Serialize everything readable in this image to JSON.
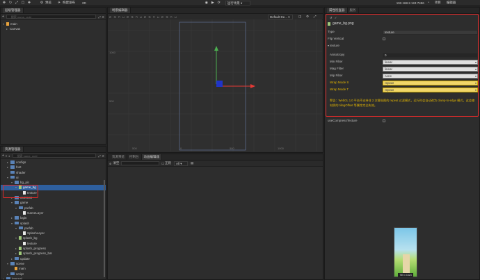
{
  "topbar": {
    "preview": "预览",
    "build": "构建发布",
    "mode": "2D",
    "scene_dropdown": "运行场景",
    "ip": "192.168.2.124:7456",
    "project": "项目",
    "editor": "编辑器"
  },
  "hierarchy": {
    "title": "层级管理器",
    "search_placeholder": "搜索 name, uuid",
    "nodes": [
      {
        "label": "main",
        "level": 0,
        "arrow": "▾"
      },
      {
        "label": "Canvas",
        "level": 1,
        "arrow": "▸"
      }
    ]
  },
  "scene": {
    "title": "场景编辑器",
    "design_dropdown": "Default De...",
    "axis_labels": [
      "1000",
      "500",
      "0",
      "500",
      "1000"
    ],
    "y_labels": [
      "1000",
      "500"
    ]
  },
  "assets": {
    "title": "资源管理器",
    "search_placeholder": "搜索 name, uuid",
    "items": [
      {
        "label": "configs",
        "level": 1,
        "arrow": "▸",
        "type": "folder"
      },
      {
        "label": "font",
        "level": 1,
        "arrow": "▸",
        "type": "folder"
      },
      {
        "label": "shader",
        "level": 1,
        "arrow": "",
        "type": "folder"
      },
      {
        "label": "ui",
        "level": 1,
        "arrow": "▾",
        "type": "folder"
      },
      {
        "label": "bg_pic",
        "level": 2,
        "arrow": "▾",
        "type": "folder"
      },
      {
        "label": "game_bg",
        "level": 3,
        "arrow": "▾",
        "type": "image",
        "selected": true
      },
      {
        "label": "texture",
        "level": 4,
        "arrow": "",
        "type": "file"
      },
      {
        "label": "common",
        "level": 2,
        "arrow": "▸",
        "type": "folder"
      },
      {
        "label": "game",
        "level": 2,
        "arrow": "▾",
        "type": "folder"
      },
      {
        "label": "prefab",
        "level": 3,
        "arrow": "▾",
        "type": "folder"
      },
      {
        "label": "GameLayer",
        "level": 4,
        "arrow": "",
        "type": "file"
      },
      {
        "label": "login",
        "level": 2,
        "arrow": "▸",
        "type": "folder"
      },
      {
        "label": "splash",
        "level": 2,
        "arrow": "▾",
        "type": "folder"
      },
      {
        "label": "prefab",
        "level": 3,
        "arrow": "▾",
        "type": "folder"
      },
      {
        "label": "SplashLayer",
        "level": 4,
        "arrow": "",
        "type": "file"
      },
      {
        "label": "splash_bg",
        "level": 3,
        "arrow": "▾",
        "type": "image"
      },
      {
        "label": "texture",
        "level": 4,
        "arrow": "",
        "type": "file"
      },
      {
        "label": "splash_progress",
        "level": 3,
        "arrow": "▸",
        "type": "image"
      },
      {
        "label": "splash_progress_bar",
        "level": 3,
        "arrow": "▸",
        "type": "image"
      },
      {
        "label": "update",
        "level": 2,
        "arrow": "▸",
        "type": "folder"
      },
      {
        "label": "scene",
        "level": 1,
        "arrow": "▾",
        "type": "folder"
      },
      {
        "label": "main",
        "level": 2,
        "arrow": "",
        "type": "scene"
      },
      {
        "label": "script",
        "level": 1,
        "arrow": "▸",
        "type": "folder"
      },
      {
        "label": "internal",
        "level": 0,
        "arrow": "▸",
        "type": "folder"
      }
    ]
  },
  "console": {
    "tabs": [
      "资源预览",
      "控制台",
      "动画编辑器"
    ],
    "clear": "清空",
    "regex": "正则",
    "level": "All"
  },
  "inspector": {
    "tabs": [
      "属性检查器",
      "服务"
    ],
    "filename": "game_bg.png",
    "type_label": "Type",
    "type_value": "texture",
    "flip_label": "Flip Vertical",
    "section": "texture",
    "anisotropy_label": "Anisotropy",
    "anisotropy_value": "0",
    "min_filter_label": "Min Filter",
    "min_filter_value": "linear",
    "mag_filter_label": "Mag Filter",
    "mag_filter_value": "linear",
    "mip_filter_label": "Mip Filter",
    "mip_filter_value": "none",
    "wrap_s_label": "Wrap Mode S",
    "wrap_s_value": "repeat",
    "wrap_t_label": "Wrap Mode T",
    "wrap_t_value": "repeat",
    "warning": "警告：WebGL 1.0 平台不支持非 2 次幂贴图的 repeat 过滤模式，运行时会自动改为 clamp-to-edge 模式，这会使材质的 tilingOffset 等属性完全失效。",
    "compress_label": "useCompressTexture",
    "preview_size": "750 x 1624"
  },
  "colors": {
    "accent": "#2e5f9e",
    "highlight": "#e02b2b",
    "warning": "#e3b600"
  }
}
